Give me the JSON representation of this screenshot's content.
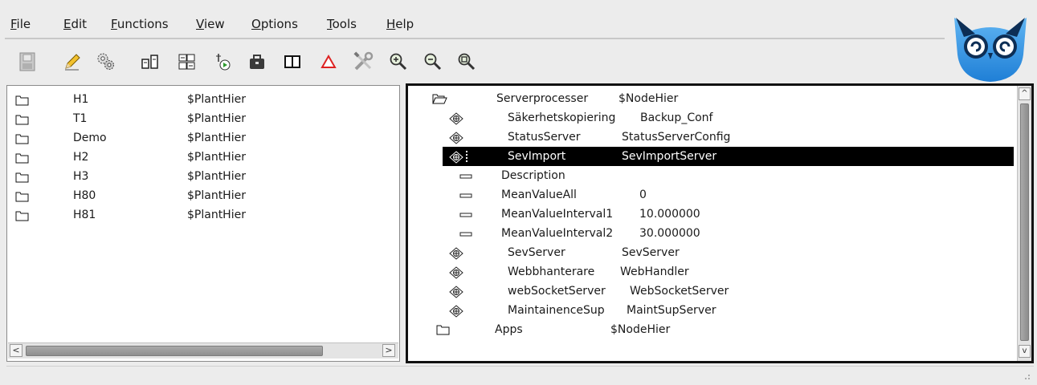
{
  "menubar": {
    "items": [
      {
        "label": "File",
        "mnemonic": "F",
        "rest": "ile"
      },
      {
        "label": "Edit",
        "mnemonic": "E",
        "rest": "dit"
      },
      {
        "label": "Functions",
        "mnemonic": "F",
        "rest": "unctions"
      },
      {
        "label": "View",
        "mnemonic": "V",
        "rest": "iew"
      },
      {
        "label": "Options",
        "mnemonic": "O",
        "rest": "ptions"
      },
      {
        "label": "Tools",
        "mnemonic": "T",
        "rest": "ools"
      },
      {
        "label": "Help",
        "mnemonic": "H",
        "rest": "elp"
      }
    ]
  },
  "toolbar": {
    "icons": [
      "save-icon",
      "edit-pencil-icon",
      "configure-gears-icon",
      "distribute-icon",
      "build-icon",
      "run-icon",
      "package-icon",
      "two-columns-icon",
      "warning-triangle-icon",
      "tools-icon",
      "zoom-in-icon",
      "zoom-out-icon",
      "zoom-reset-icon"
    ]
  },
  "colors": {
    "background": "#ececec",
    "selected_row": "#000000",
    "selected_text": "#ffffff",
    "logo_blue": "#2a8fe0"
  },
  "left_pane": {
    "rows": [
      {
        "name": "H1",
        "class": "$PlantHier"
      },
      {
        "name": "T1",
        "class": "$PlantHier"
      },
      {
        "name": "Demo",
        "class": "$PlantHier"
      },
      {
        "name": "H2",
        "class": "$PlantHier"
      },
      {
        "name": "H3",
        "class": "$PlantHier"
      },
      {
        "name": "H80",
        "class": "$PlantHier"
      },
      {
        "name": "H81",
        "class": "$PlantHier"
      }
    ]
  },
  "right_pane": {
    "rows": [
      {
        "icon": "open-folder-icon",
        "name": "Serverprocesser",
        "value": "$NodeHier"
      },
      {
        "icon": "server-object-icon",
        "name": "Säkerhetskopiering",
        "value": "Backup_Conf"
      },
      {
        "icon": "server-object-icon",
        "name": "StatusServer",
        "value": "StatusServerConfig"
      },
      {
        "icon": "server-object-icon",
        "name": "SevImport",
        "value": "SevImportServer",
        "selected": true
      },
      {
        "icon": "attribute-icon",
        "name": "Description",
        "value": ""
      },
      {
        "icon": "attribute-icon",
        "name": "MeanValueAll",
        "value": "0"
      },
      {
        "icon": "attribute-icon",
        "name": "MeanValueInterval1",
        "value": "10.000000"
      },
      {
        "icon": "attribute-icon",
        "name": "MeanValueInterval2",
        "value": "30.000000"
      },
      {
        "icon": "server-object-icon",
        "name": "SevServer",
        "value": "SevServer"
      },
      {
        "icon": "server-object-icon",
        "name": "Webbhanterare",
        "value": "WebHandler"
      },
      {
        "icon": "server-object-icon",
        "name": "webSocketServer",
        "value": "WebSocketServer"
      },
      {
        "icon": "server-object-icon",
        "name": "MaintainenceSup",
        "value": "MaintSupServer"
      },
      {
        "icon": "folder-icon",
        "name": "Apps",
        "value": "$NodeHier"
      }
    ]
  },
  "scrollbars": {
    "left_horizontal": {
      "position_fraction": 0.0,
      "visible_fraction": 0.8
    },
    "right_vertical": {
      "position_fraction": 0.0,
      "visible_fraction": 0.97
    }
  }
}
